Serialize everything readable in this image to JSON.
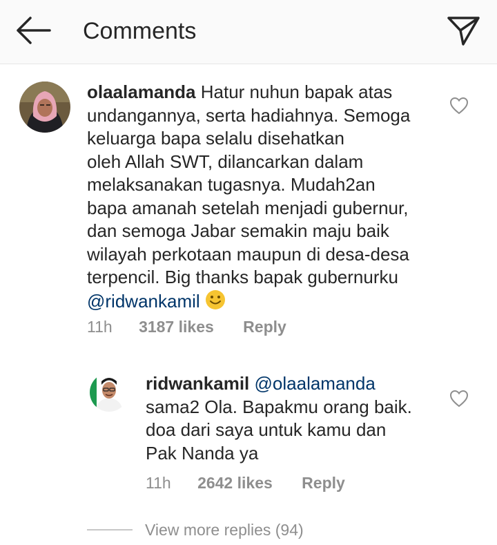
{
  "header": {
    "title": "Comments",
    "back_icon": "arrow-left-icon",
    "send_icon": "paper-plane-icon"
  },
  "comments": [
    {
      "username": "olaalamanda",
      "lines": [
        "Hatur nuhun bapak atas",
        "undangannya, serta hadiahnya. Semoga",
        "keluarga bapa selalu disehatkan",
        "oleh Allah SWT, dilancarkan dalam",
        "melaksanakan tugasnya. Mudah2an",
        "bapa amanah setelah menjadi gubernur,",
        "dan semoga Jabar semakin maju baik",
        "wilayah perkotaan maupun di desa-desa",
        "terpencil. Big thanks bapak gubernurku"
      ],
      "mention": "@ridwankamil",
      "emoji": "smiley-emoji",
      "time": "11h",
      "likes": "3187 likes",
      "reply": "Reply"
    },
    {
      "username": "ridwankamil",
      "mention": "@olaalamanda",
      "lines": [
        "sama2 Ola. Bapakmu orang baik.",
        "doa dari saya untuk kamu dan",
        "Pak Nanda ya"
      ],
      "time": "11h",
      "likes": "2642 likes",
      "reply": "Reply"
    }
  ],
  "view_more": "View more replies (94)",
  "colors": {
    "mention": "#003569",
    "meta": "#8e8e8e",
    "text": "#262626"
  }
}
